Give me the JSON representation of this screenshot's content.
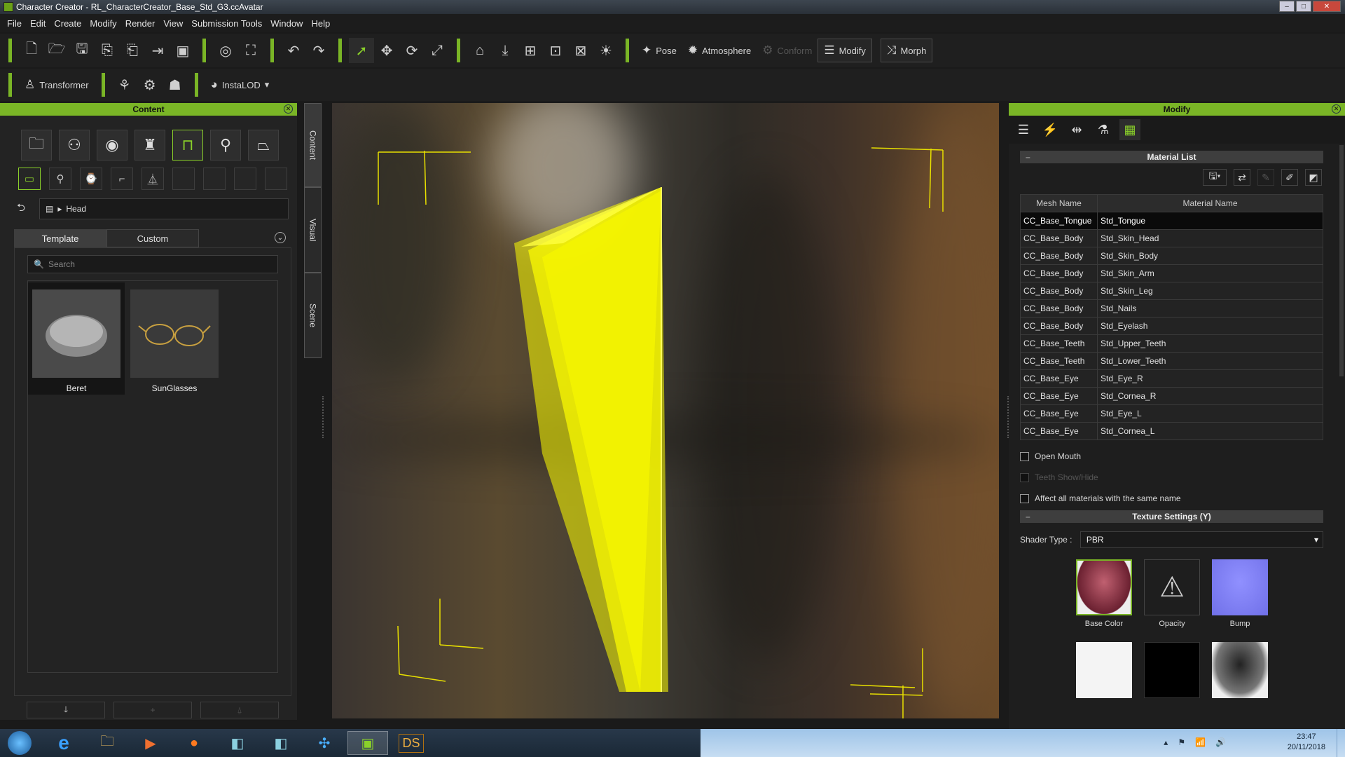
{
  "window": {
    "title": "Character Creator - RL_CharacterCreator_Base_Std_G3.ccAvatar"
  },
  "menu": [
    "File",
    "Edit",
    "Create",
    "Modify",
    "Render",
    "View",
    "Submission Tools",
    "Window",
    "Help"
  ],
  "toolbar": {
    "pose": "Pose",
    "atmosphere": "Atmosphere",
    "conform": "Conform",
    "modify": "Modify",
    "morph": "Morph",
    "transformer": "Transformer",
    "instalod": "InstaLOD"
  },
  "content_panel": {
    "title": "Content",
    "breadcrumb": "Head",
    "tabs": [
      "Template",
      "Custom"
    ],
    "search_placeholder": "Search",
    "items": [
      {
        "label": "Beret"
      },
      {
        "label": "SunGlasses"
      }
    ]
  },
  "side_tabs": [
    "Content",
    "Visual",
    "Scene"
  ],
  "modify_panel": {
    "title": "Modify",
    "material_list_title": "Material List",
    "columns": [
      "Mesh Name",
      "Material Name"
    ],
    "rows": [
      [
        "CC_Base_Tongue",
        "Std_Tongue"
      ],
      [
        "CC_Base_Body",
        "Std_Skin_Head"
      ],
      [
        "CC_Base_Body",
        "Std_Skin_Body"
      ],
      [
        "CC_Base_Body",
        "Std_Skin_Arm"
      ],
      [
        "CC_Base_Body",
        "Std_Skin_Leg"
      ],
      [
        "CC_Base_Body",
        "Std_Nails"
      ],
      [
        "CC_Base_Body",
        "Std_Eyelash"
      ],
      [
        "CC_Base_Teeth",
        "Std_Upper_Teeth"
      ],
      [
        "CC_Base_Teeth",
        "Std_Lower_Teeth"
      ],
      [
        "CC_Base_Eye",
        "Std_Eye_R"
      ],
      [
        "CC_Base_Eye",
        "Std_Cornea_R"
      ],
      [
        "CC_Base_Eye",
        "Std_Eye_L"
      ],
      [
        "CC_Base_Eye",
        "Std_Cornea_L"
      ]
    ],
    "open_mouth": "Open Mouth",
    "teeth_show_hide": "Teeth Show/Hide",
    "affect_all": "Affect all materials with the same name",
    "texture_settings_title": "Texture Settings  (Y)",
    "shader_type_label": "Shader Type :",
    "shader_type_value": "PBR",
    "textures": [
      "Base Color",
      "Opacity",
      "Bump"
    ]
  },
  "taskbar": {
    "time": "23:47",
    "date": "20/11/2018",
    "ds_label": "DS"
  },
  "colors": {
    "accent": "#7ab526",
    "selection": "#ffff00"
  }
}
